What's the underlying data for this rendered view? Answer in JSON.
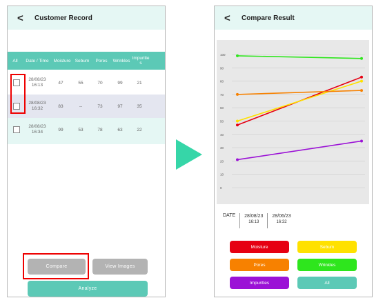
{
  "left_screen": {
    "back_glyph": "<",
    "title": "Customer Record",
    "headers": [
      "All",
      "Date / Time",
      "Moisture",
      "Sebum",
      "Pores",
      "Wrinkles",
      "Impurities"
    ],
    "rows": [
      {
        "date": "28/08/23",
        "time": "16:13",
        "moisture": "47",
        "sebum": "55",
        "pores": "70",
        "wrinkles": "99",
        "impurities": "21"
      },
      {
        "date": "28/08/23",
        "time": "16:32",
        "moisture": "83",
        "sebum": "--",
        "pores": "73",
        "wrinkles": "97",
        "impurities": "35"
      },
      {
        "date": "28/08/23",
        "time": "16:34",
        "moisture": "99",
        "sebum": "53",
        "pores": "78",
        "wrinkles": "63",
        "impurities": "22"
      }
    ],
    "compare_label": "Compare",
    "view_images_label": "View Images",
    "analyze_label": "Analyze"
  },
  "right_screen": {
    "back_glyph": "<",
    "title": "Compare Result",
    "date_label": "DATE",
    "dates": [
      {
        "date": "28/08/23",
        "time": "16:13"
      },
      {
        "date": "28/06/23",
        "time": "16:32"
      }
    ],
    "legend_buttons": [
      {
        "label": "Moisture",
        "color": "#e60012"
      },
      {
        "label": "Sebum",
        "color": "#ffe100"
      },
      {
        "label": "Pores",
        "color": "#f78100"
      },
      {
        "label": "Wrinkles",
        "color": "#2ee61d"
      },
      {
        "label": "Impurities",
        "color": "#9b12d6"
      },
      {
        "label": "All",
        "color": "#5cc9b6"
      }
    ]
  },
  "chart_data": {
    "type": "line",
    "x": [
      "28/08/23 16:13",
      "28/06/23 16:32"
    ],
    "yticks": [
      "100",
      "90",
      "80",
      "70",
      "60",
      "50",
      "40",
      "30",
      "20",
      "10",
      "0"
    ],
    "ylim": [
      0,
      100
    ],
    "series": [
      {
        "name": "Moisture",
        "color": "#e60012",
        "values": [
          47,
          83
        ]
      },
      {
        "name": "Sebum",
        "color": "#ffe100",
        "values": [
          50,
          80
        ]
      },
      {
        "name": "Pores",
        "color": "#f78100",
        "values": [
          70,
          73
        ]
      },
      {
        "name": "Wrinkles",
        "color": "#2ee61d",
        "values": [
          99,
          97
        ]
      },
      {
        "name": "Impurities",
        "color": "#9b12d6",
        "values": [
          21,
          35
        ]
      }
    ]
  },
  "colors": {
    "accent": "#5cc9b6",
    "header_bg": "#e5f7f4",
    "arrow": "#36d6a8",
    "highlight": "#ee0000"
  }
}
